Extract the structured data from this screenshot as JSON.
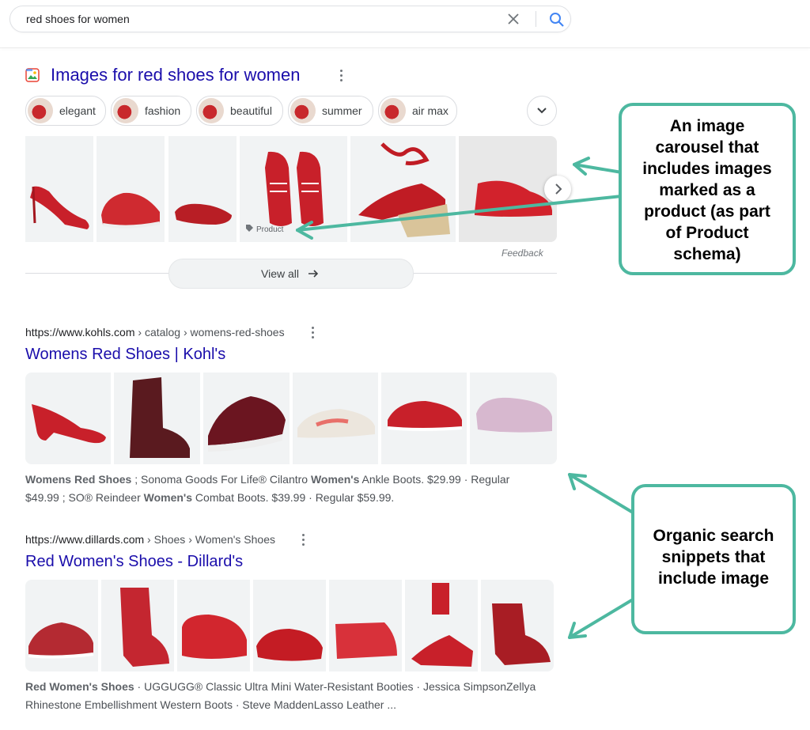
{
  "search": {
    "query": "red shoes for women"
  },
  "images_section": {
    "title": "Images for red shoes for women",
    "chips": [
      "elegant",
      "fashion",
      "beautiful",
      "summer",
      "air max"
    ],
    "product_label": "Product",
    "feedback": "Feedback",
    "view_all": "View all"
  },
  "results": [
    {
      "domain": "https://www.kohls.com",
      "path": " › catalog › womens-red-shoes",
      "title": "Womens Red Shoes | Kohl's",
      "snippet_line1": {
        "b1": "Womens Red Shoes",
        "t1": " ; Sonoma Goods For Life® Cilantro ",
        "b2": "Women's",
        "t2": " Ankle Boots. $29.99 · Regular"
      },
      "snippet_line2": {
        "t1": "$49.99 ; SO® Reindeer ",
        "b1": "Women's",
        "t2": " Combat Boots. $39.99 · Regular $59.99."
      }
    },
    {
      "domain": "https://www.dillards.com",
      "path": " › Shoes › Women's Shoes",
      "title": "Red Women's Shoes - Dillard's",
      "snippet_line1": {
        "b1": "Red Women's Shoes",
        "t1": " · UGGUGG® Classic Ultra Mini Water-Resistant Booties · Jessica SimpsonZellya"
      },
      "snippet_line2": {
        "t1": "Rhinestone Embellishment Western Boots · Steve MaddenLasso Leather ..."
      }
    }
  ],
  "callouts": {
    "top": [
      "An image",
      "carousel that",
      "includes images",
      "marked as a",
      "product (as part",
      "of Product",
      "schema)"
    ],
    "bottom": [
      "Organic search",
      "snippets that",
      "include image"
    ]
  },
  "colors": {
    "link": "#1a0dab",
    "callout_border": "#4db8a0",
    "shoe_red": "#c8202a"
  },
  "icons": [
    "clear-icon",
    "search-icon",
    "image-icon",
    "more-vert-icon",
    "chevron-down-icon",
    "chevron-right-icon",
    "arrow-right-icon",
    "tag-icon"
  ]
}
